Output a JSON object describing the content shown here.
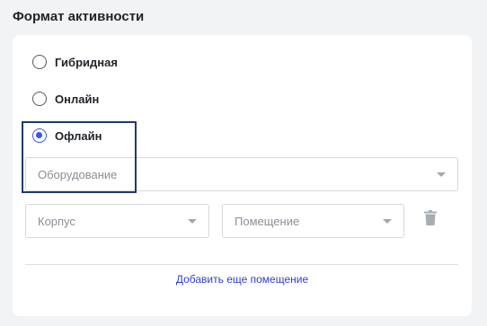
{
  "section": {
    "title": "Формат активности"
  },
  "format_options": [
    {
      "label": "Гибридная",
      "checked": false
    },
    {
      "label": "Онлайн",
      "checked": false
    },
    {
      "label": "Офлайн",
      "checked": true
    }
  ],
  "equipment_select": {
    "placeholder": "Оборудование"
  },
  "building_select": {
    "placeholder": "Корпус"
  },
  "room_select": {
    "placeholder": "Помещение"
  },
  "icons": {
    "delete": "trash-icon",
    "dropdown": "caret-down-icon"
  },
  "actions": {
    "add_room": "Добавить еще помещение"
  },
  "colors": {
    "accent": "#3a57e8",
    "link": "#2f3fc4",
    "highlight_border": "#1f3a6e"
  }
}
